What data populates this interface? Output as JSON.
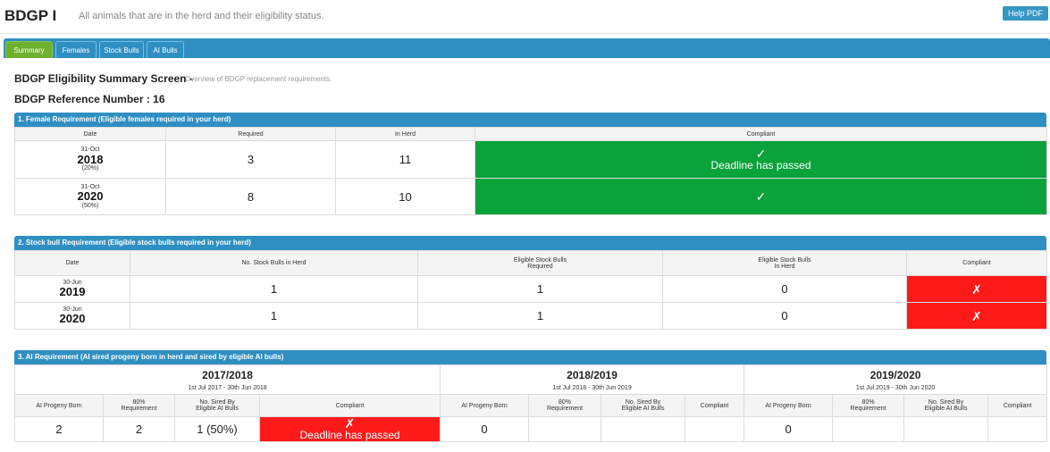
{
  "header": {
    "title": "BDGP I",
    "subtitle": "All animals that are in the herd and their eligibility status.",
    "help_button": "Help PDF"
  },
  "tabs": [
    {
      "label": "Summary",
      "active": true
    },
    {
      "label": "Females",
      "active": false
    },
    {
      "label": "Stock Bulls",
      "active": false
    },
    {
      "label": "AI Bulls",
      "active": false
    }
  ],
  "summary": {
    "title": "BDGP Eligibility Summary Screen -",
    "subtitle": "Overview of BDGP replacement requirements.",
    "reference": "BDGP Reference Number : 16"
  },
  "female": {
    "section_title": "1. Female Requirement (Eligible females required in your herd)",
    "headers": {
      "date": "Date",
      "required": "Required",
      "in_herd": "In Herd",
      "compliant": "Compliant"
    },
    "rows": [
      {
        "day": "31-Oct",
        "year": "2018",
        "pct": "(20%)",
        "required": "3",
        "in_herd": "11",
        "mark": "✓",
        "note": "Deadline has passed",
        "status": "green"
      },
      {
        "day": "31-Oct",
        "year": "2020",
        "pct": "(50%)",
        "required": "8",
        "in_herd": "10",
        "mark": "✓",
        "note": "",
        "status": "green"
      }
    ]
  },
  "stock": {
    "section_title": "2. Stock bull Requirement (Eligible stock bulls required in your herd)",
    "headers": {
      "date": "Date",
      "in_herd": "No. Stock Bulls in Herd",
      "req_line1": "Eligible Stock Bulls",
      "req_line2": "Required",
      "elig_line1": "Eligible Stock Bulls",
      "elig_line2": "In Herd",
      "compliant": "Compliant"
    },
    "rows": [
      {
        "day": "30-Jun",
        "year": "2019",
        "in_herd": "1",
        "required": "1",
        "eligible_in_herd": "0",
        "mark": "✗",
        "status": "red"
      },
      {
        "day": "30-Jun",
        "year": "2020",
        "in_herd": "1",
        "required": "1",
        "eligible_in_herd": "0",
        "mark": "✗",
        "status": "red"
      }
    ]
  },
  "ai": {
    "section_title": "3. AI Requirement (AI sired progeny born in herd and sired by eligible AI bulls)",
    "col_headers": {
      "born": "AI Progeny Born",
      "req_line1": "80%",
      "req_line2": "Requirement",
      "sired_line1": "No. Sired By",
      "sired_line2": "Eligible AI Bulls",
      "compliant": "Compliant"
    },
    "seasons": [
      {
        "name": "2017/2018",
        "range": "1st Jul 2017 - 30th Jun 2018",
        "born": "2",
        "requirement": "2",
        "sired": "1 (50%)",
        "mark": "✗",
        "note": "Deadline has passed",
        "status": "red"
      },
      {
        "name": "2018/2019",
        "range": "1st Jul 2018 - 30th Jun 2019",
        "born": "0",
        "requirement": "",
        "sired": "",
        "mark": "",
        "note": "",
        "status": "none"
      },
      {
        "name": "2019/2020",
        "range": "1st Jul 2019 - 30th Jun 2020",
        "born": "0",
        "requirement": "",
        "sired": "",
        "mark": "",
        "note": "",
        "status": "none"
      }
    ]
  },
  "colors": {
    "tab_bar": "#2f8fc2",
    "active_tab": "#6fb02e",
    "compliant_green": "#0aa23a",
    "noncompliant_red": "#ff1a1a"
  }
}
